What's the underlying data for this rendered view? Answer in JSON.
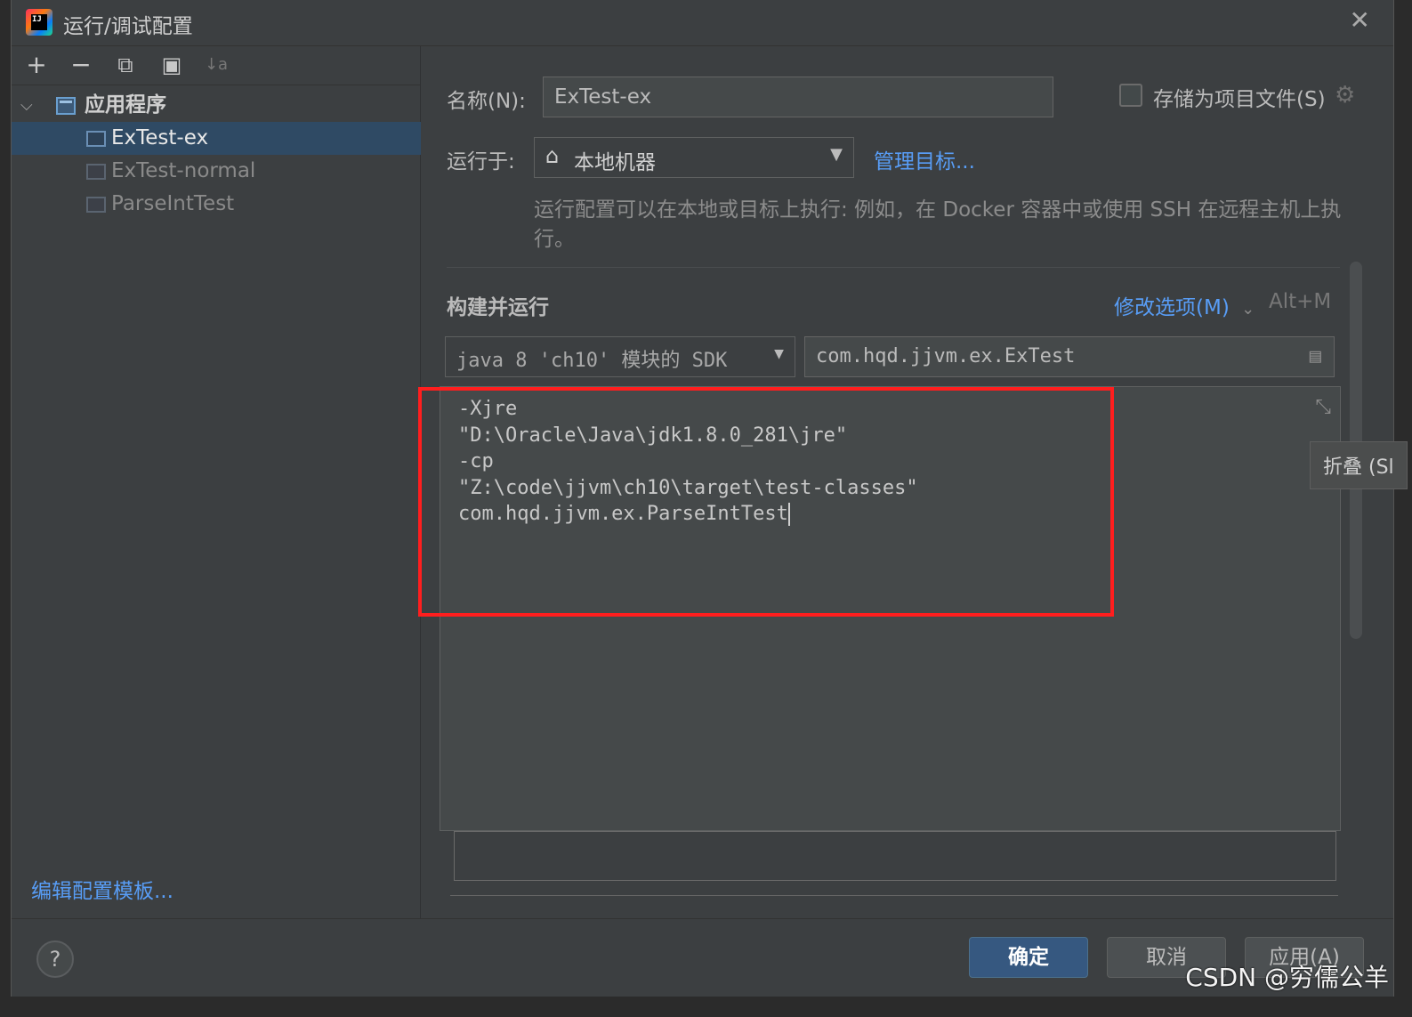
{
  "window": {
    "title": "运行/调试配置",
    "close_glyph": "✕"
  },
  "toolbar": {
    "add": "+",
    "remove": "−",
    "copy": "⧉",
    "folder": "▣",
    "sort": "↓a"
  },
  "tree": {
    "group_label": "应用程序",
    "items": [
      {
        "label": "ExTest-ex",
        "selected": true
      },
      {
        "label": "ExTest-normal",
        "selected": false
      },
      {
        "label": "ParseIntTest",
        "selected": false
      }
    ]
  },
  "left_footer": {
    "edit_templates": "编辑配置模板..."
  },
  "form": {
    "name_label": "名称(N):",
    "name_value": "ExTest-ex",
    "store_label": "存储为项目文件(S)",
    "run_on_label": "运行于:",
    "run_on_value": "本地机器",
    "manage_targets": "管理目标...",
    "hint": "运行配置可以在本地或目标上执行: 例如，在 Docker 容器中或使用 SSH 在远程主机上执行。"
  },
  "build_run": {
    "title": "构建并运行",
    "modify_options": "修改选项(M)",
    "shortcut": "Alt+M",
    "sdk_value": "java 8 'ch10' 模块的 SDK",
    "main_class": "com.hqd.jjvm.ex.ExTest",
    "program_args_lines": [
      "-Xjre",
      "\"D:\\Oracle\\Java\\jdk1.8.0_281\\jre\"",
      "-cp",
      "\"Z:\\code\\jjvm\\ch10\\target\\test-classes\"",
      "com.hqd.jjvm.ex.ParseIntTest"
    ],
    "collapse_tooltip": "折叠 (Sl"
  },
  "buttons": {
    "ok": "确定",
    "cancel": "取消",
    "apply": "应用(A)",
    "help": "?"
  },
  "watermark": "CSDN @穷儒公羊",
  "colors": {
    "highlight_box": "#ff1e1e",
    "link": "#589df6",
    "selection": "#2f4a64",
    "primary_button": "#365880"
  }
}
